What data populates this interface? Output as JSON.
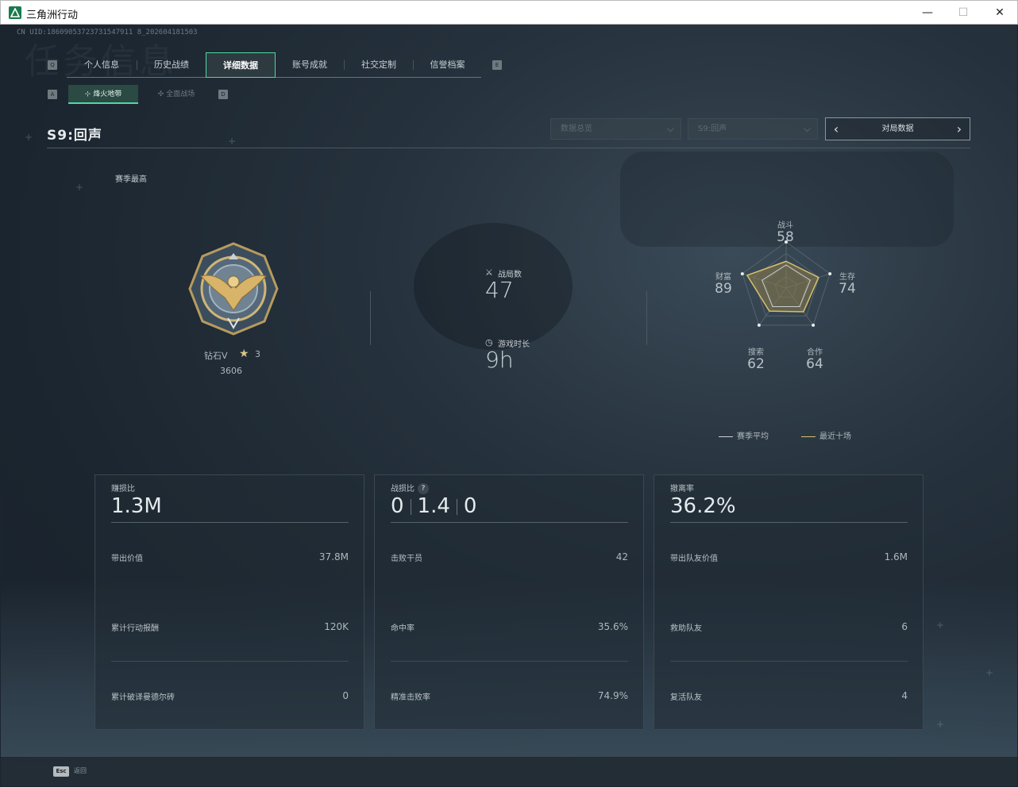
{
  "window": {
    "title": "三角洲行动",
    "minimize": "—",
    "maximize": "☐",
    "close": "✕"
  },
  "uid": "CN UID:18609053723731547911 8_202604181503",
  "watermark": "任务信息",
  "keycaps": {
    "tab_left": "Q",
    "tab_right": "E",
    "sub_left": "A",
    "sub_right": "D"
  },
  "tabs": [
    {
      "label": "个人信息"
    },
    {
      "label": "历史战绩"
    },
    {
      "label": "详细数据",
      "active": true
    },
    {
      "label": "账号成就"
    },
    {
      "label": "社交定制"
    },
    {
      "label": "信誉档案"
    }
  ],
  "subtabs": [
    {
      "label": "烽火地带",
      "active": true,
      "icon": "target-icon"
    },
    {
      "label": "全面战场",
      "active": false,
      "icon": "crosshair-icon"
    }
  ],
  "season": {
    "title": "S9:回声",
    "best_label": "赛季最高"
  },
  "filters": {
    "data_scope": "数据总览",
    "season_select": "S9:回声",
    "pager_label": "对局数据",
    "prev_icon": "chevron-left-icon",
    "next_icon": "chevron-right-icon"
  },
  "rank": {
    "name": "钻石V",
    "stars": "3",
    "score": "3606",
    "badge_icon": "eagle-badge-icon"
  },
  "summary": {
    "matches_label": "战局数",
    "matches_value": "47",
    "playtime_label": "游戏时长",
    "playtime_value": "9h"
  },
  "radar": {
    "axes": [
      {
        "label": "战斗",
        "value": "58"
      },
      {
        "label": "生存",
        "value": "74"
      },
      {
        "label": "合作",
        "value": "64"
      },
      {
        "label": "搜索",
        "value": "62"
      },
      {
        "label": "财富",
        "value": "89"
      }
    ],
    "season_avg": [
      0.5,
      0.55,
      0.5,
      0.5,
      0.55
    ],
    "recent": [
      0.58,
      0.74,
      0.64,
      0.62,
      0.89
    ],
    "legend_avg": "赛季平均",
    "legend_recent": "最近十场",
    "colors": {
      "avg": "#c8cfd2",
      "recent": "#d6c16a",
      "fill": "#8c7c4a"
    }
  },
  "cards": [
    {
      "head_label": "赚损比",
      "head_value": "1.3M",
      "rows": [
        {
          "label": "带出价值",
          "value": "37.8M"
        },
        {
          "label": "累计行动报酬",
          "value": "120K"
        },
        {
          "label": "累计破译曼德尔砖",
          "value": "0"
        }
      ]
    },
    {
      "head_label": "战损比",
      "help": "?",
      "head_value_a": "0",
      "head_value_b": "1.4",
      "head_value_c": "0",
      "rows": [
        {
          "label": "击败干员",
          "value": "42"
        },
        {
          "label": "命中率",
          "value": "35.6%"
        },
        {
          "label": "精准击败率",
          "value": "74.9%"
        }
      ]
    },
    {
      "head_label": "撤离率",
      "head_value": "36.2%",
      "rows": [
        {
          "label": "带出队友价值",
          "value": "1.6M"
        },
        {
          "label": "救助队友",
          "value": "6"
        },
        {
          "label": "复活队友",
          "value": "4"
        }
      ]
    }
  ],
  "footer": {
    "esc_key": "Esc",
    "esc_label": "返回"
  }
}
